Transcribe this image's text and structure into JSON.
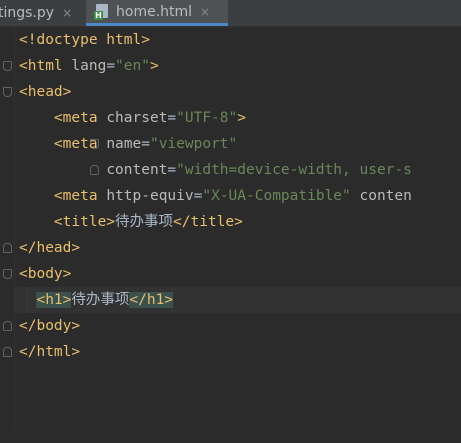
{
  "tabs": [
    {
      "label": "tings.py",
      "active": false
    },
    {
      "label": "home.html",
      "active": true
    }
  ],
  "icons": {
    "tab_close": "×",
    "file_icon_letter": "H"
  },
  "code": {
    "l1": {
      "a": "<!doctype html>"
    },
    "l2": {
      "a": "<html ",
      "b": "lang",
      "c": "=",
      "d": "\"en\"",
      "e": ">"
    },
    "l3": {
      "a": "<head>"
    },
    "l4": {
      "indent": "    ",
      "a": "<meta ",
      "b": "charset",
      "c": "=",
      "d": "\"UTF-8\"",
      "e": ">"
    },
    "l5": {
      "indent": "    ",
      "a": "<meta ",
      "b": "name",
      "c": "=",
      "d": "\"viewport\""
    },
    "l6": {
      "indent": "          ",
      "b": "content",
      "c": "=",
      "d": "\"width=device-width, user-s"
    },
    "l7": {
      "indent": "    ",
      "a": "<meta ",
      "b": "http-equiv",
      "c": "=",
      "d": "\"X-UA-Compatible\"",
      "e": " conten"
    },
    "l8": {
      "indent": "    ",
      "a": "<title>",
      "t": "待办事项",
      "e": "</title>"
    },
    "l9": {
      "a": "</head>"
    },
    "l10": {
      "a": "<body>"
    },
    "l11": {
      "indent": "  ",
      "a": "<h1>",
      "t": "待办事项",
      "e": "</h1>"
    },
    "l12": {
      "a": "</body>"
    },
    "l13": {
      "a": "</html>"
    }
  },
  "colors": {
    "background": "#2b2b2b",
    "tag": "#e8bf6a",
    "attribute": "#bababa",
    "string": "#6a8759",
    "text": "#a9b7c6",
    "active_tab_underline": "#4a88c7"
  }
}
